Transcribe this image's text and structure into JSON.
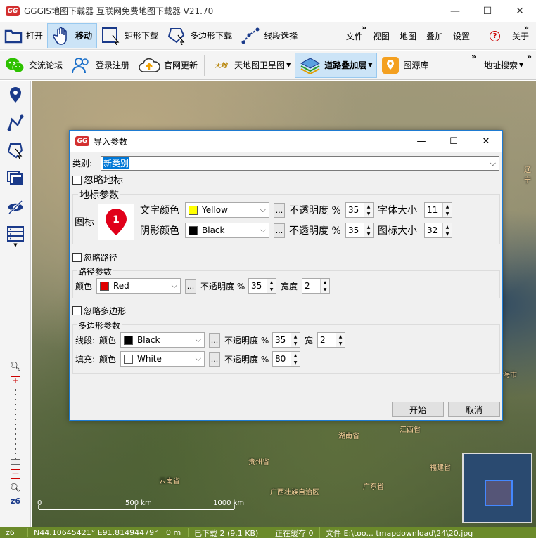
{
  "window": {
    "title": "GGGIS地图下载器  互联网免费地图下载器 V21.70",
    "logo": "GG"
  },
  "toolbar1": {
    "open": "打开",
    "move": "移动",
    "rect_download": "矩形下载",
    "poly_download": "多边形下载",
    "line_select": "线段选择",
    "menus": [
      "文件",
      "视图",
      "地图",
      "叠加",
      "设置",
      "关于"
    ]
  },
  "toolbar2": {
    "forum": "交流论坛",
    "login": "登录注册",
    "update": "官网更新",
    "tianditu": "天地图卫星图",
    "road_overlay": "道路叠加层",
    "source_lib": "图源库",
    "address_search": "地址搜索"
  },
  "map": {
    "labels": [
      {
        "text": "江西省"
      },
      {
        "text": "湖南省"
      },
      {
        "text": "贵州省"
      },
      {
        "text": "云南省"
      },
      {
        "text": "广西壮族自治区"
      },
      {
        "text": "广东省"
      },
      {
        "text": "福建省"
      },
      {
        "text": "辽宁"
      },
      {
        "text": "海市"
      }
    ],
    "scale_0": "0",
    "scale_500": "500 km",
    "scale_1000": "1000 km",
    "zoom_level": "z6"
  },
  "statusbar": {
    "zoom": "z6",
    "coords": "N44.10645421° E91.81494479°",
    "distance": "0 m",
    "downloaded": "已下载 2 (9.1 KB)",
    "saving": "正在缓存 0",
    "file": "文件 E:\\too... tmapdownload\\24\\20.jpg"
  },
  "dialog": {
    "title": "导入参数",
    "category_label": "类别:",
    "category_value": "新类别",
    "ignore_marker": "忽略地标",
    "marker_params": "地标参数",
    "icon_label": "图标",
    "marker_number": "1",
    "text_color_label": "文字颜色",
    "text_color": "Yellow",
    "shadow_color_label": "阴影颜色",
    "shadow_color": "Black",
    "opacity_label": "不透明度 %",
    "text_opacity": "35",
    "shadow_opacity": "35",
    "font_size_label": "字体大小",
    "font_size": "11",
    "icon_size_label": "图标大小",
    "icon_size": "32",
    "ignore_path": "忽略路径",
    "path_params": "路径参数",
    "color_label": "颜色",
    "path_color": "Red",
    "path_opacity_label": "不透明度 %",
    "path_opacity": "35",
    "width_label": "宽度",
    "path_width": "2",
    "ignore_polygon": "忽略多边形",
    "polygon_params": "多边形参数",
    "line_label": "线段:",
    "fill_label": "填充:",
    "poly_color_label": "颜色",
    "line_color": "Black",
    "line_opacity": "35",
    "line_width_label": "宽",
    "line_width": "2",
    "fill_color": "White",
    "fill_opacity": "80",
    "start_button": "开始",
    "cancel_button": "取消",
    "dots": "..."
  },
  "colors": {
    "yellow": "#ffff00",
    "black": "#000000",
    "red": "#e00000",
    "white": "#ffffff",
    "accent": "#1e7bd2"
  }
}
